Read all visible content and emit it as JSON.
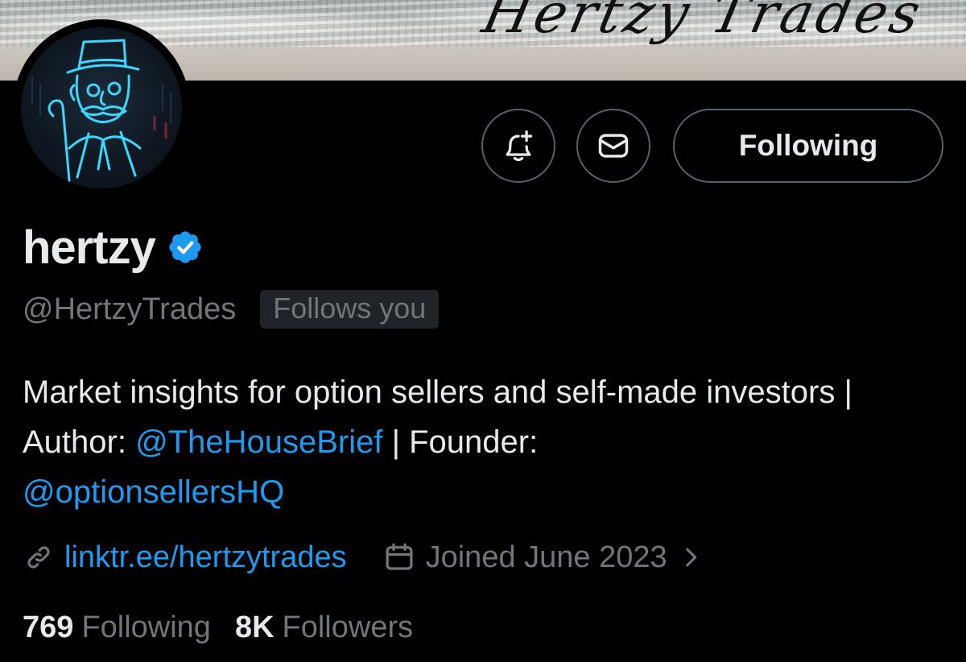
{
  "banner": {
    "text": "Hertzy Trades"
  },
  "profile": {
    "display_name": "hertzy",
    "verified": true,
    "handle": "@HertzyTrades",
    "follows_you_label": "Follows you",
    "bio": {
      "part1": "Market insights for option sellers and self-made investors | Author: ",
      "mention1": "@TheHouseBrief",
      "part2": " | Founder: ",
      "mention2": "@optionsellersHQ"
    },
    "website": "linktr.ee/hertzytrades",
    "joined": "Joined June 2023"
  },
  "actions": {
    "notify_icon": "bell-plus-icon",
    "message_icon": "envelope-icon",
    "following_label": "Following"
  },
  "stats": {
    "following_count": "769",
    "following_label": "Following",
    "followers_count": "8K",
    "followers_label": "Followers"
  },
  "colors": {
    "background": "#000000",
    "text_primary": "#e7e9ea",
    "text_secondary": "#71767b",
    "accent": "#1d9bf0",
    "border": "#536471",
    "avatar_neon": "#3ad7ff"
  },
  "icons": {
    "verified": "verified-badge-icon",
    "link": "link-icon",
    "calendar": "calendar-icon",
    "chevron": "chevron-right-icon"
  }
}
